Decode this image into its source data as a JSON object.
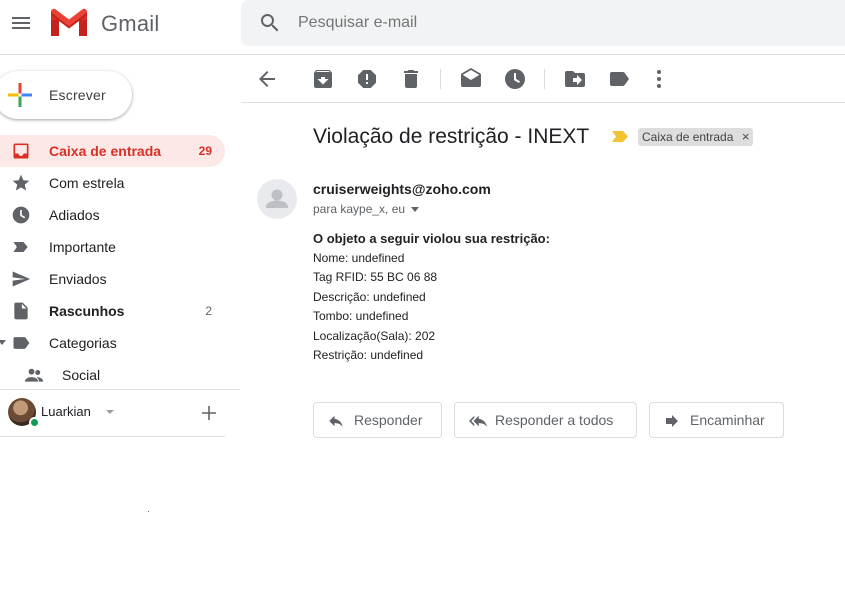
{
  "app": {
    "name": "Gmail"
  },
  "search": {
    "placeholder": "Pesquisar e-mail"
  },
  "compose": {
    "label": "Escrever"
  },
  "sidebar": {
    "items": [
      {
        "label": "Caixa de entrada",
        "count": "29",
        "icon": "inbox-icon"
      },
      {
        "label": "Com estrela",
        "count": "",
        "icon": "star-icon"
      },
      {
        "label": "Adiados",
        "count": "",
        "icon": "clock-icon"
      },
      {
        "label": "Importante",
        "count": "",
        "icon": "important-icon"
      },
      {
        "label": "Enviados",
        "count": "",
        "icon": "send-icon"
      },
      {
        "label": "Rascunhos",
        "count": "2",
        "icon": "draft-icon"
      },
      {
        "label": "Categorias",
        "count": "",
        "icon": "label-icon"
      },
      {
        "label": "Social",
        "count": "",
        "icon": "people-icon"
      }
    ]
  },
  "hangouts": {
    "user_name": "Luarkian"
  },
  "toolbar": {
    "buttons": [
      "back-icon",
      "archive-icon",
      "report-spam-icon",
      "delete-icon",
      "mark-unread-icon",
      "snooze-icon",
      "move-to-icon",
      "labels-icon",
      "more-icon"
    ]
  },
  "message": {
    "subject": "Violação de restrição - INEXT",
    "label_chip": "Caixa de entrada",
    "sender": "cruiserweights@zoho.com",
    "recipients": "para kaype_x, eu",
    "body_title": "O objeto a seguir violou sua restrição:",
    "body_lines": [
      "Nome: undefined",
      "Tag RFID: 55 BC 06 88",
      "Descrição: undefined",
      "Tombo: undefined",
      "Localização(Sala): 202",
      "Restrição: undefined"
    ]
  },
  "actions": {
    "reply": "Responder",
    "reply_all": "Responder a todos",
    "forward": "Encaminhar"
  },
  "colors": {
    "accent_red": "#d93025",
    "active_bg": "#fce8e6",
    "important_marker": "#f4c430"
  }
}
